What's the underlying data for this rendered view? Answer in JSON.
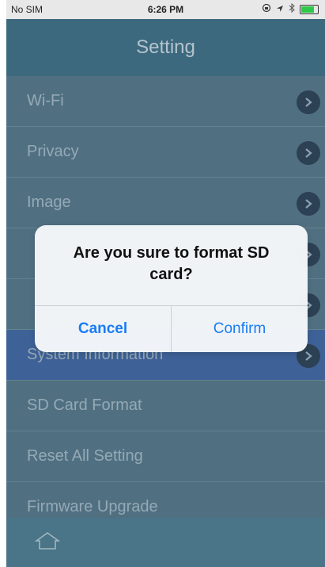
{
  "status_bar": {
    "carrier": "No SIM",
    "time": "6:26 PM"
  },
  "header": {
    "title": "Setting"
  },
  "settings": [
    {
      "label": "Wi-Fi",
      "has_chevron": true
    },
    {
      "label": "Privacy",
      "has_chevron": true
    },
    {
      "label": "Image",
      "has_chevron": true
    },
    {
      "label": "",
      "has_chevron": true
    },
    {
      "label": "",
      "has_chevron": true
    },
    {
      "label": "System Information",
      "has_chevron": true
    },
    {
      "label": "SD Card Format",
      "has_chevron": false
    },
    {
      "label": "Reset All Setting",
      "has_chevron": false
    },
    {
      "label": "Firmware Upgrade",
      "has_chevron": false
    }
  ],
  "dialog": {
    "message": "Are you sure to format SD card?",
    "cancel_label": "Cancel",
    "confirm_label": "Confirm"
  },
  "tab_bar": {
    "icon": "home-icon"
  },
  "colors": {
    "accent": "#1a7cf5",
    "header": "#3e6f86",
    "highlight_row": "#3f66a4"
  }
}
